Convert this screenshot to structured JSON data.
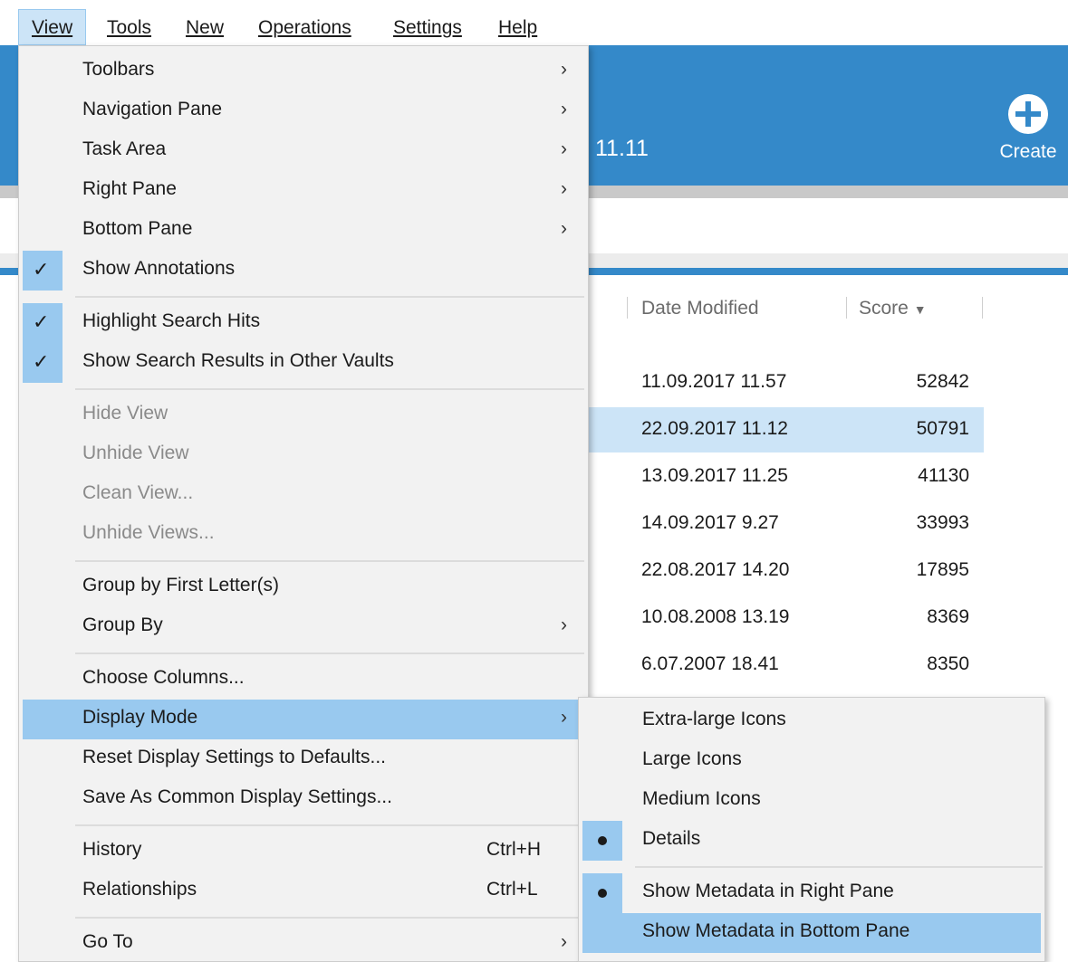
{
  "menubar": {
    "items": [
      {
        "label": "View",
        "active": true
      },
      {
        "label": "Tools"
      },
      {
        "label": "New"
      },
      {
        "label": "Operations"
      },
      {
        "label": "Settings"
      },
      {
        "label": "Help"
      }
    ]
  },
  "banner": {
    "date_fragment": "11.11",
    "create_label": "Create"
  },
  "table": {
    "headers": [
      "Date Modified",
      "Score"
    ],
    "sort_indicator": "descending",
    "rows": [
      {
        "date": "11.09.2017 11.57",
        "score": "52842"
      },
      {
        "date": "22.09.2017 11.12",
        "score": "50791",
        "selected": true
      },
      {
        "date": "13.09.2017 11.25",
        "score": "41130"
      },
      {
        "date": "14.09.2017 9.27",
        "score": "33993"
      },
      {
        "date": "22.08.2017 14.20",
        "score": "17895"
      },
      {
        "date": "10.08.2008 13.19",
        "score": "8369"
      },
      {
        "date": "6.07.2007 18.41",
        "score": "8350"
      }
    ]
  },
  "view_menu": {
    "items": [
      {
        "label": "Toolbars",
        "submenu": true
      },
      {
        "label": "Navigation Pane",
        "submenu": true
      },
      {
        "label": "Task Area",
        "submenu": true
      },
      {
        "label": "Right Pane",
        "submenu": true
      },
      {
        "label": "Bottom Pane",
        "submenu": true
      },
      {
        "label": "Show Annotations",
        "checked": true
      },
      {
        "label": "Highlight Search Hits",
        "checked": true
      },
      {
        "label": "Show Search Results in Other Vaults",
        "checked": true
      },
      {
        "label": "Hide View",
        "disabled": true
      },
      {
        "label": "Unhide View",
        "disabled": true
      },
      {
        "label": "Clean View...",
        "disabled": true
      },
      {
        "label": "Unhide Views...",
        "disabled": true
      },
      {
        "label": "Group by First Letter(s)"
      },
      {
        "label": "Group By",
        "submenu": true
      },
      {
        "label": "Choose Columns..."
      },
      {
        "label": "Display Mode",
        "submenu": true,
        "highlighted": true
      },
      {
        "label": "Reset Display Settings to Defaults..."
      },
      {
        "label": "Save As Common Display Settings..."
      },
      {
        "label": "History",
        "shortcut": "Ctrl+H"
      },
      {
        "label": "Relationships",
        "shortcut": "Ctrl+L"
      },
      {
        "label": "Go To",
        "submenu": true
      }
    ]
  },
  "display_mode_submenu": {
    "items": [
      {
        "label": "Extra-large Icons"
      },
      {
        "label": "Large Icons"
      },
      {
        "label": "Medium Icons"
      },
      {
        "label": "Details",
        "selected": true
      },
      {
        "label": "Show Metadata in Right Pane",
        "selected": true
      },
      {
        "label": "Show Metadata in Bottom Pane",
        "highlighted": true
      }
    ]
  },
  "colors": {
    "accent": "#3489c9",
    "menu_highlight": "#99c9ef",
    "row_selected": "#cce4f7"
  }
}
